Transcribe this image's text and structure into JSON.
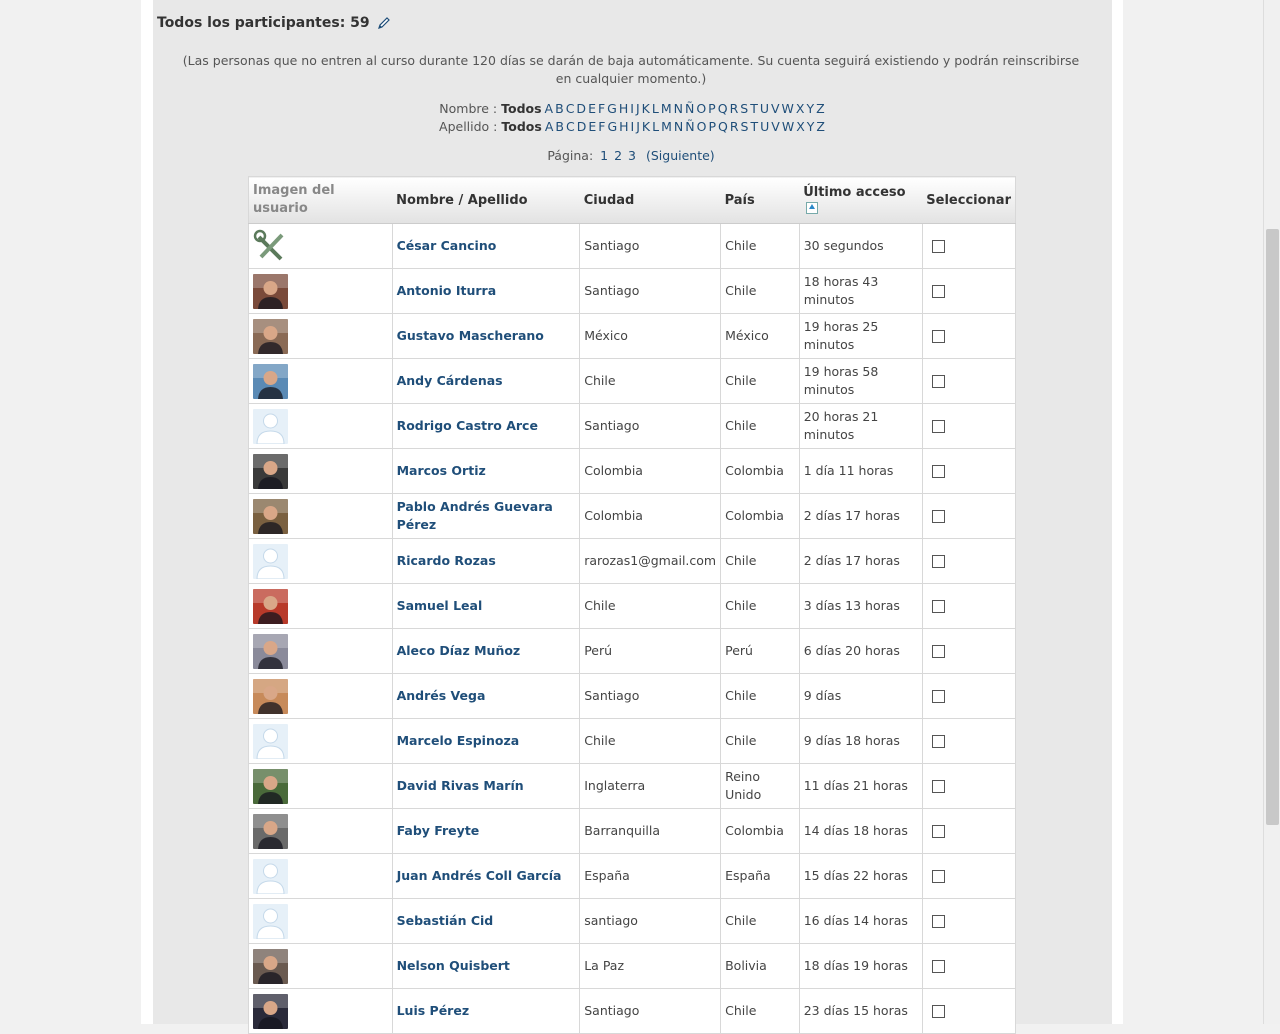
{
  "title": "Todos los participantes: 59",
  "notice": "(Las personas que no entren al curso durante 120 días se darán de baja automáticamente. Su cuenta seguirá existiendo y podrán reinscribirse en cualquier momento.)",
  "filter": {
    "nombre_label": "Nombre :",
    "apellido_label": "Apellido :",
    "all": "Todos",
    "letters": [
      "A",
      "B",
      "C",
      "D",
      "E",
      "F",
      "G",
      "H",
      "I",
      "J",
      "K",
      "L",
      "M",
      "N",
      "Ñ",
      "O",
      "P",
      "Q",
      "R",
      "S",
      "T",
      "U",
      "V",
      "W",
      "X",
      "Y",
      "Z"
    ]
  },
  "pager": {
    "label": "Página:",
    "pages": [
      "1",
      "2",
      "3"
    ],
    "next": "(Siguiente)"
  },
  "table": {
    "headers": {
      "image": "Imagen del usuario",
      "name": "Nombre / Apellido",
      "city": "Ciudad",
      "country": "País",
      "last_access": "Último acceso",
      "select": "Seleccionar"
    },
    "rows": [
      {
        "name": "César Cancino",
        "city": "Santiago",
        "country": "Chile",
        "last": "30 segundos",
        "avatar": "tools",
        "color": "#6d8f6d"
      },
      {
        "name": "Antonio Iturra",
        "city": "Santiago",
        "country": "Chile",
        "last": "18 horas 43 minutos",
        "avatar": "photo",
        "color": "#7a4a3a"
      },
      {
        "name": "Gustavo Mascherano",
        "city": "México",
        "country": "México",
        "last": "19 horas 25 minutos",
        "avatar": "photo",
        "color": "#8a6a55"
      },
      {
        "name": "Andy Cárdenas",
        "city": "Chile",
        "country": "Chile",
        "last": "19 horas 58 minutos",
        "avatar": "photo",
        "color": "#5a8ab5"
      },
      {
        "name": "Rodrigo Castro Arce",
        "city": "Santiago",
        "country": "Chile",
        "last": "20 horas 21 minutos",
        "avatar": "default",
        "color": "#cfe3f2"
      },
      {
        "name": "Marcos Ortiz",
        "city": "Colombia",
        "country": "Colombia",
        "last": "1 día 11 horas",
        "avatar": "photo",
        "color": "#3a3a3a"
      },
      {
        "name": "Pablo Andrés Guevara Pérez",
        "city": "Colombia",
        "country": "Colombia",
        "last": "2 días 17 horas",
        "avatar": "photo",
        "color": "#7a6040"
      },
      {
        "name": "Ricardo Rozas",
        "city": "rarozas1@gmail.com",
        "country": "Chile",
        "last": "2 días 17 horas",
        "avatar": "default",
        "color": "#cfe3f2"
      },
      {
        "name": "Samuel Leal",
        "city": "Chile",
        "country": "Chile",
        "last": "3 días 13 horas",
        "avatar": "photo",
        "color": "#b83a2a"
      },
      {
        "name": "Aleco Díaz Muñoz",
        "city": "Perú",
        "country": "Perú",
        "last": "6 días 20 horas",
        "avatar": "photo",
        "color": "#8a8a9a"
      },
      {
        "name": "Andrés Vega",
        "city": "Santiago",
        "country": "Chile",
        "last": "9 días",
        "avatar": "photo",
        "color": "#c78a5a"
      },
      {
        "name": "Marcelo Espinoza",
        "city": "Chile",
        "country": "Chile",
        "last": "9 días 18 horas",
        "avatar": "default",
        "color": "#cfe3f2"
      },
      {
        "name": "David Rivas Marín",
        "city": "Inglaterra",
        "country": "Reino Unido",
        "last": "11 días 21 horas",
        "avatar": "photo",
        "color": "#4a6a3a"
      },
      {
        "name": "Faby Freyte",
        "city": "Barranquilla",
        "country": "Colombia",
        "last": "14 días 18 horas",
        "avatar": "photo",
        "color": "#6a6a6a"
      },
      {
        "name": "Juan Andrés Coll García",
        "city": "España",
        "country": "España",
        "last": "15 días 22 horas",
        "avatar": "default",
        "color": "#cfe3f2"
      },
      {
        "name": "Sebastián Cid",
        "city": "santiago",
        "country": "Chile",
        "last": "16 días 14 horas",
        "avatar": "default",
        "color": "#cfe3f2"
      },
      {
        "name": "Nelson Quisbert",
        "city": "La Paz",
        "country": "Bolivia",
        "last": "18 días 19 horas",
        "avatar": "photo",
        "color": "#6a5a50"
      },
      {
        "name": "Luis Pérez",
        "city": "Santiago",
        "country": "Chile",
        "last": "23 días 15 horas",
        "avatar": "photo",
        "color": "#2a2a3a"
      }
    ]
  }
}
